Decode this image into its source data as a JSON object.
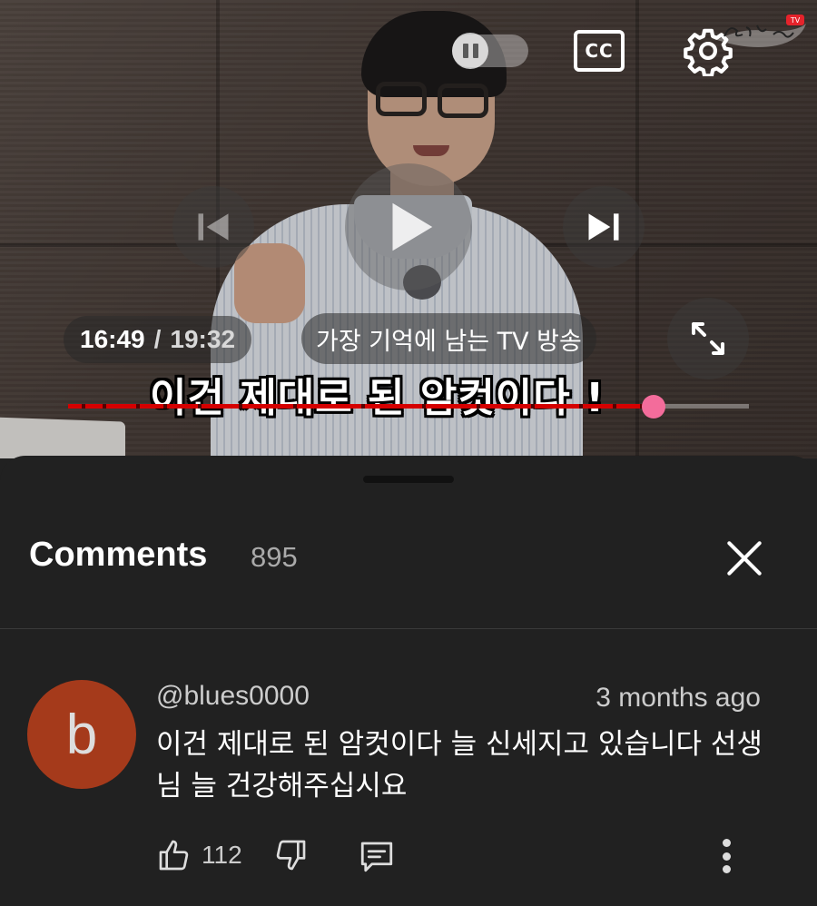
{
  "player": {
    "current_time": "16:49",
    "separator": "/",
    "duration": "19:32",
    "chapter_title": "가장 기억에 남는 TV 방송",
    "subtitle": "이건 제대로 된 암컷이다 !",
    "cc_label": "CC",
    "progress": 0.86,
    "chapter_markers": [
      0.02,
      0.05,
      0.1,
      0.14,
      0.19,
      0.25,
      0.33,
      0.43,
      0.52,
      0.6,
      0.68,
      0.75,
      0.8,
      0.84
    ],
    "accent_color": "#d50000",
    "knob_color": "#f36c9b",
    "icons": {
      "pause": "pause-icon",
      "cc": "captions-icon",
      "settings": "gear-icon",
      "previous": "skip-previous-icon",
      "play": "play-icon",
      "next": "skip-next-icon",
      "fullscreen": "fullscreen-icon"
    }
  },
  "comments": {
    "title": "Comments",
    "count": "895",
    "close_icon": "close-icon",
    "items": [
      {
        "avatar_letter": "b",
        "avatar_color": "#a53a1b",
        "author": "@blues0000",
        "time_ago": "3 months ago",
        "text": "이건 제대로 된 암컷이다 늘 신세지고 있습니다 선생님 늘 건강해주십시요",
        "likes": "112"
      }
    ]
  }
}
